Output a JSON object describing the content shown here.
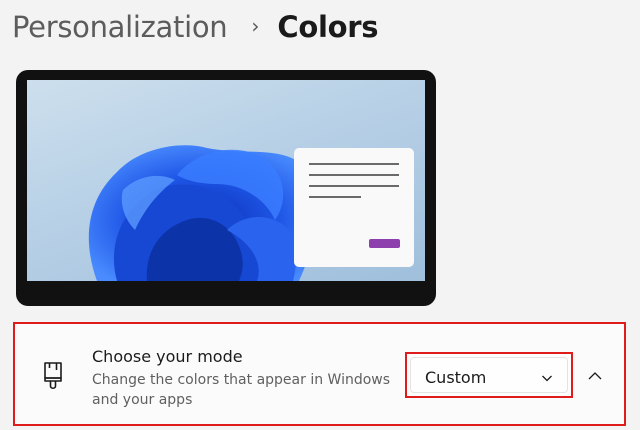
{
  "breadcrumb": {
    "parent": "Personalization",
    "separator": "›",
    "current": "Colors"
  },
  "preview": {
    "accent_color": "#8e3fae"
  },
  "mode_setting": {
    "icon": "paint-brush-icon",
    "title": "Choose your mode",
    "description": "Change the colors that appear in Windows and your apps",
    "selected_value": "Custom",
    "expand_icon": "chevron-up-icon"
  },
  "highlight_color": "#e01b1b"
}
